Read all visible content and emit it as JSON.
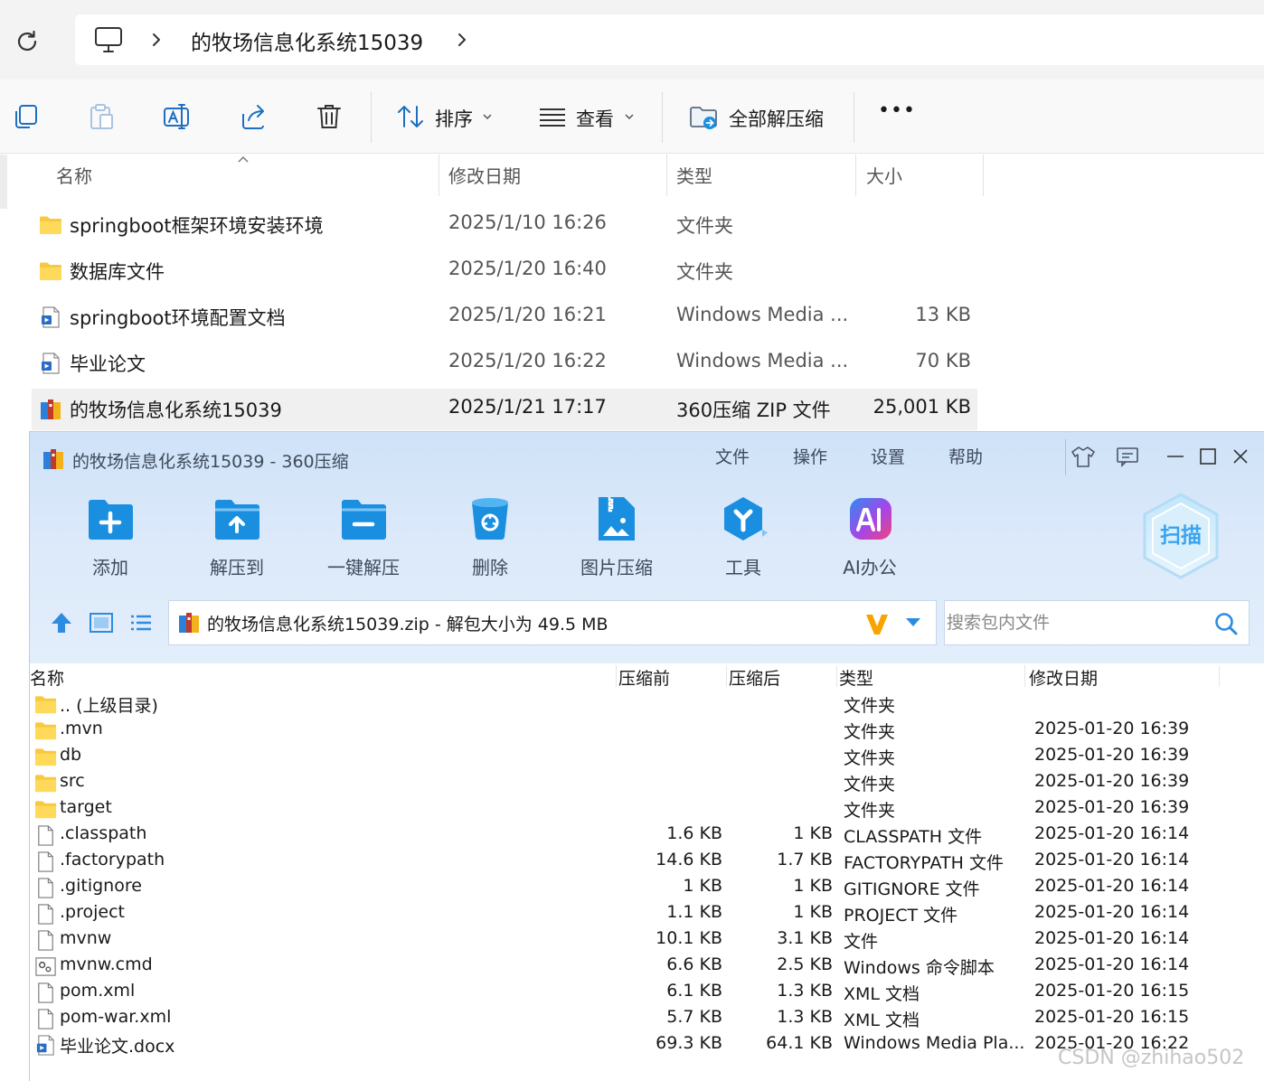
{
  "explorer": {
    "address": {
      "path": "的牧场信息化系统15039"
    },
    "toolbar": {
      "sort_label": "排序",
      "view_label": "查看",
      "extract_all_label": "全部解压缩",
      "more_label": "•••"
    },
    "columns": {
      "name": "名称",
      "date": "修改日期",
      "type": "类型",
      "size": "大小"
    },
    "files": [
      {
        "icon": "folder-icon",
        "name": "springboot框架环境安装环境",
        "date": "2025/1/10 16:26",
        "type": "文件夹",
        "size": ""
      },
      {
        "icon": "folder-icon",
        "name": "数据库文件",
        "date": "2025/1/20 16:40",
        "type": "文件夹",
        "size": ""
      },
      {
        "icon": "media-file-icon",
        "name": "springboot环境配置文档",
        "date": "2025/1/20 16:21",
        "type": "Windows Media ...",
        "size": "13 KB"
      },
      {
        "icon": "media-file-icon",
        "name": "毕业论文",
        "date": "2025/1/20 16:22",
        "type": "Windows Media ...",
        "size": "70 KB"
      },
      {
        "icon": "zip-archive-icon",
        "name": "的牧场信息化系统15039",
        "date": "2025/1/21 17:17",
        "type": "360压缩 ZIP 文件",
        "size": "25,001 KB"
      }
    ]
  },
  "zip": {
    "title": "的牧场信息化系统15039 - 360压缩",
    "menu": [
      "文件",
      "操作",
      "设置",
      "帮助"
    ],
    "tools": [
      {
        "icon": "add-icon",
        "label": "添加"
      },
      {
        "icon": "extract-to-icon",
        "label": "解压到"
      },
      {
        "icon": "one-click-extract-icon",
        "label": "一键解压"
      },
      {
        "icon": "delete-icon",
        "label": "删除"
      },
      {
        "icon": "image-compress-icon",
        "label": "图片压缩"
      },
      {
        "icon": "tools-icon",
        "label": "工具"
      },
      {
        "icon": "ai-office-icon",
        "label": "AI办公"
      }
    ],
    "scan_label": "扫描",
    "path_text": "的牧场信息化系统15039.zip - 解包大小为 49.5 MB",
    "search_placeholder": "搜索包内文件",
    "columns": {
      "name": "名称",
      "before": "压缩前",
      "after": "压缩后",
      "type": "类型",
      "date": "修改日期"
    },
    "entries": [
      {
        "icon": "folder-icon",
        "name": ".. (上级目录)",
        "before": "",
        "after": "",
        "type": "文件夹",
        "date": ""
      },
      {
        "icon": "folder-icon",
        "name": ".mvn",
        "before": "",
        "after": "",
        "type": "文件夹",
        "date": "2025-01-20 16:39"
      },
      {
        "icon": "folder-icon",
        "name": "db",
        "before": "",
        "after": "",
        "type": "文件夹",
        "date": "2025-01-20 16:39"
      },
      {
        "icon": "folder-icon",
        "name": "src",
        "before": "",
        "after": "",
        "type": "文件夹",
        "date": "2025-01-20 16:39"
      },
      {
        "icon": "folder-icon",
        "name": "target",
        "before": "",
        "after": "",
        "type": "文件夹",
        "date": "2025-01-20 16:39"
      },
      {
        "icon": "file-icon",
        "name": ".classpath",
        "before": "1.6 KB",
        "after": "1 KB",
        "type": "CLASSPATH 文件",
        "date": "2025-01-20 16:14"
      },
      {
        "icon": "file-icon",
        "name": ".factorypath",
        "before": "14.6 KB",
        "after": "1.7 KB",
        "type": "FACTORYPATH 文件",
        "date": "2025-01-20 16:14"
      },
      {
        "icon": "file-icon",
        "name": ".gitignore",
        "before": "1 KB",
        "after": "1 KB",
        "type": "GITIGNORE 文件",
        "date": "2025-01-20 16:14"
      },
      {
        "icon": "file-icon",
        "name": ".project",
        "before": "1.1 KB",
        "after": "1 KB",
        "type": "PROJECT 文件",
        "date": "2025-01-20 16:14"
      },
      {
        "icon": "file-icon",
        "name": "mvnw",
        "before": "10.1 KB",
        "after": "3.1 KB",
        "type": "文件",
        "date": "2025-01-20 16:14"
      },
      {
        "icon": "script-file-icon",
        "name": "mvnw.cmd",
        "before": "6.6 KB",
        "after": "2.5 KB",
        "type": "Windows 命令脚本",
        "date": "2025-01-20 16:14"
      },
      {
        "icon": "file-icon",
        "name": "pom.xml",
        "before": "6.1 KB",
        "after": "1.3 KB",
        "type": "XML 文档",
        "date": "2025-01-20 16:15"
      },
      {
        "icon": "file-icon",
        "name": "pom-war.xml",
        "before": "5.7 KB",
        "after": "1.3 KB",
        "type": "XML 文档",
        "date": "2025-01-20 16:15"
      },
      {
        "icon": "media-file-icon",
        "name": "毕业论文.docx",
        "before": "69.3 KB",
        "after": "64.1 KB",
        "type": "Windows Media Pla...",
        "date": "2025-01-20 16:22"
      }
    ]
  },
  "watermark": "CSDN @zhihao502",
  "colors": {
    "explorer_bg": "#f3f3f3",
    "zip_header_bg": "#d6e6f9",
    "zip_accent": "#1a8fe0",
    "folder_yellow": "#f8c93e"
  }
}
